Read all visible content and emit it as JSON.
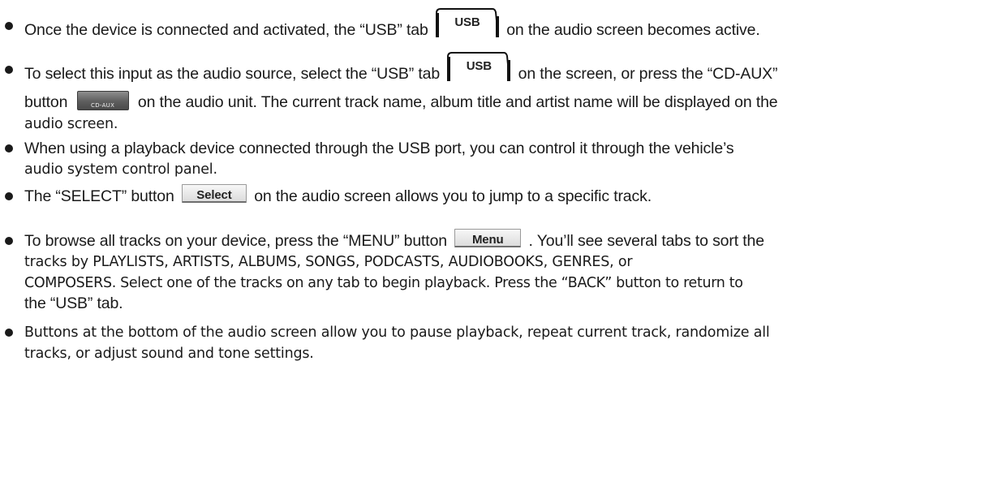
{
  "tabs": {
    "usb_label": "USB"
  },
  "buttons": {
    "cdaux_label": "CD-AUX",
    "select_label": "Select",
    "menu_label": "Menu"
  },
  "bullets": [
    {
      "lines": [
        {
          "before": "Once the device is connected and activated, the “USB” tab",
          "after": "on the audio screen becomes active."
        }
      ]
    },
    {
      "lines": [
        {
          "before": "To select this input as the audio source, select the “USB” tab",
          "after": "on the screen, or press the “CD-AUX”"
        },
        {
          "before": "button",
          "after": "on the audio unit. The current track name, album title and artist name will be displayed on the"
        },
        {
          "text": "audio screen."
        }
      ]
    },
    {
      "lines": [
        {
          "text": "When using a playback device connected through the USB port, you can control it through the vehicle’s"
        },
        {
          "text": "audio system control panel."
        }
      ]
    },
    {
      "lines": [
        {
          "before": "The “SELECT” button",
          "after": "on the audio screen allows you to jump to a specific track."
        }
      ]
    },
    {
      "lines": [
        {
          "before": "To browse all tracks on your device, press the “MENU” button",
          "after": ". You’ll see several tabs to sort the"
        },
        {
          "text": "tracks by PLAYLISTS, ARTISTS, ALBUMS, SONGS, PODCASTS, AUDIOBOOKS, GENRES, or"
        },
        {
          "text": "COMPOSERS. Select one of the tracks on any tab to begin playback. Press the “BACK” button to return to"
        },
        {
          "text": "the “USB” tab."
        }
      ]
    },
    {
      "lines": [
        {
          "text": "Buttons at the bottom of the audio screen allow you to pause playback, repeat current track, randomize all"
        },
        {
          "text": "tracks, or adjust sound and tone settings."
        }
      ]
    }
  ]
}
